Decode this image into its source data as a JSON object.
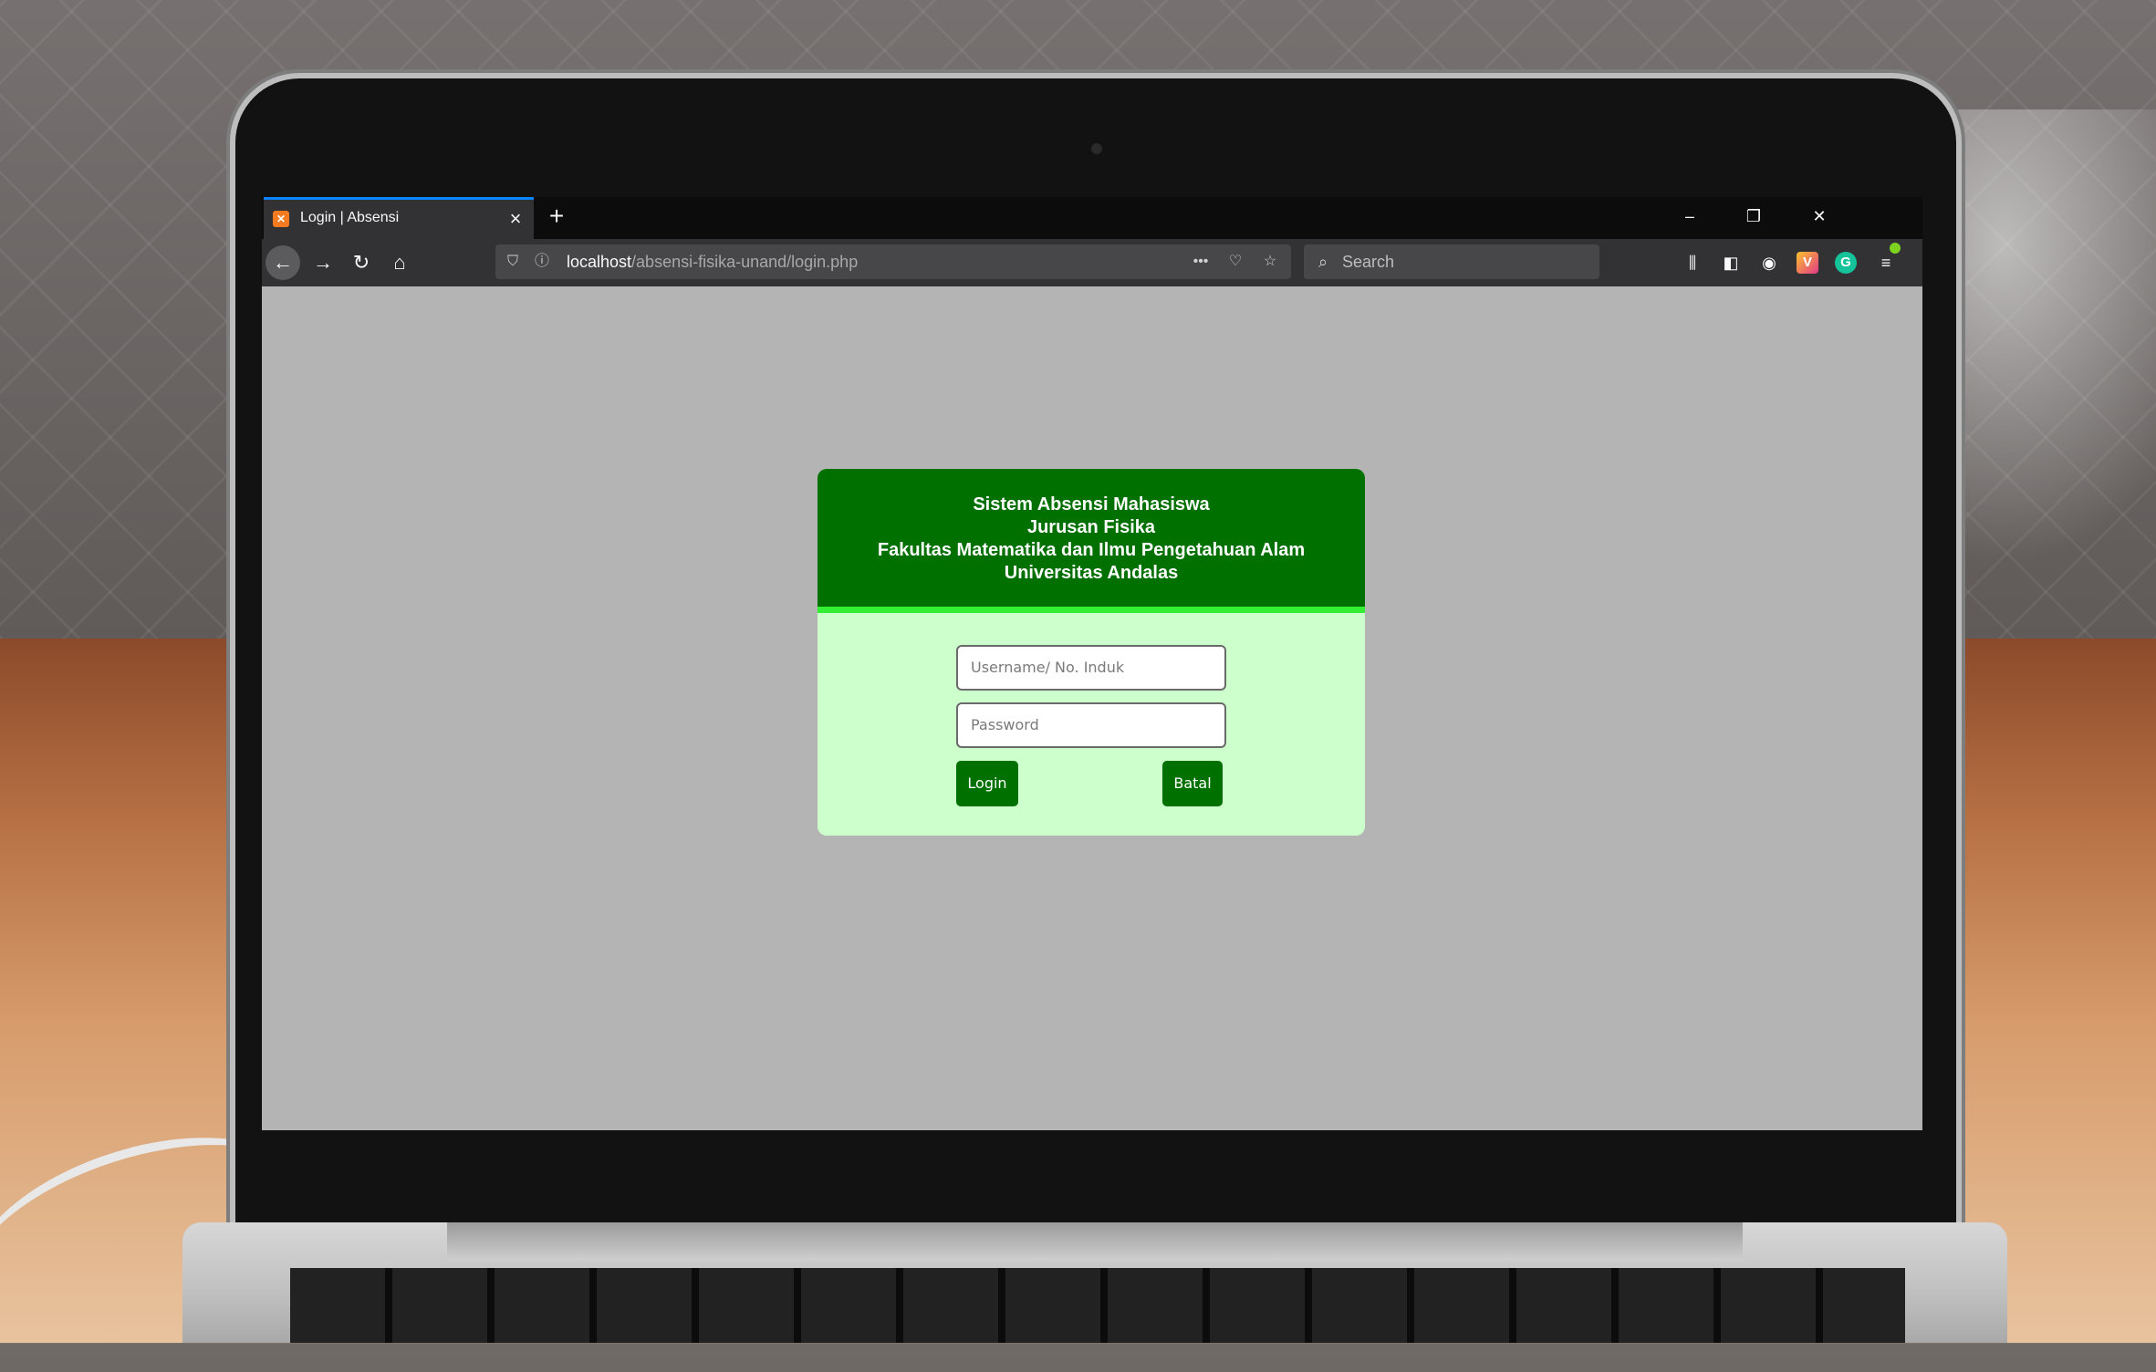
{
  "browser": {
    "tab_title": "Login | Absensi",
    "tab_favicon": "xampp-icon",
    "new_tab_label": "+",
    "url_host": "localhost",
    "url_path": "/absensi-fisika-unand/login.php",
    "search_placeholder": "Search",
    "accent_color": "#0a84ff"
  },
  "page": {
    "header_lines": [
      "Sistem Absensi Mahasiswa",
      "Jurusan Fisika",
      "Fakultas Matematika dan Ilmu Pengetahuan Alam",
      "Universitas Andalas"
    ],
    "username_placeholder": "Username/ No. Induk",
    "password_placeholder": "Password",
    "login_label": "Login",
    "cancel_label": "Batal",
    "header_color": "#007000",
    "header_stripe_color": "#33ee33",
    "card_color": "#ccffcc"
  }
}
